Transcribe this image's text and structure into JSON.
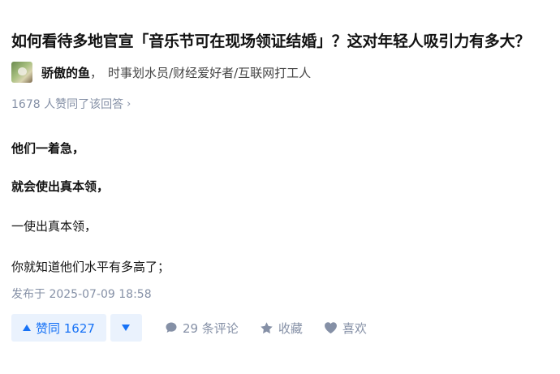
{
  "question": {
    "title": "如何看待多地官宣「音乐节可在现场领证结婚」？这对年轻人吸引力有多大？"
  },
  "author": {
    "name": "骄傲的鱼",
    "separator": "，",
    "bio": "时事划水员/财经爱好者/互联网打工人"
  },
  "vote_summary": {
    "text": "1678 人赞同了该回答",
    "chevron": "›"
  },
  "content": {
    "paragraphs": [
      "他们一着急，",
      "就会使出真本领，",
      "一使出真本领，",
      "你就知道他们水平有多高了；"
    ]
  },
  "meta": {
    "publish_time": "发布于 2025-07-09 18:58"
  },
  "actions": {
    "upvote_label": "赞同 1627",
    "comments_label": "29 条评论",
    "collect_label": "收藏",
    "like_label": "喜欢"
  },
  "colors": {
    "accent": "#1772f6",
    "accent_bg": "#eaf2fd",
    "muted": "#8590a6",
    "text": "#121212"
  },
  "icons": [
    "caret-up-icon",
    "caret-down-icon",
    "comment-bubble-icon",
    "star-icon",
    "heart-icon",
    "chevron-right-icon"
  ]
}
